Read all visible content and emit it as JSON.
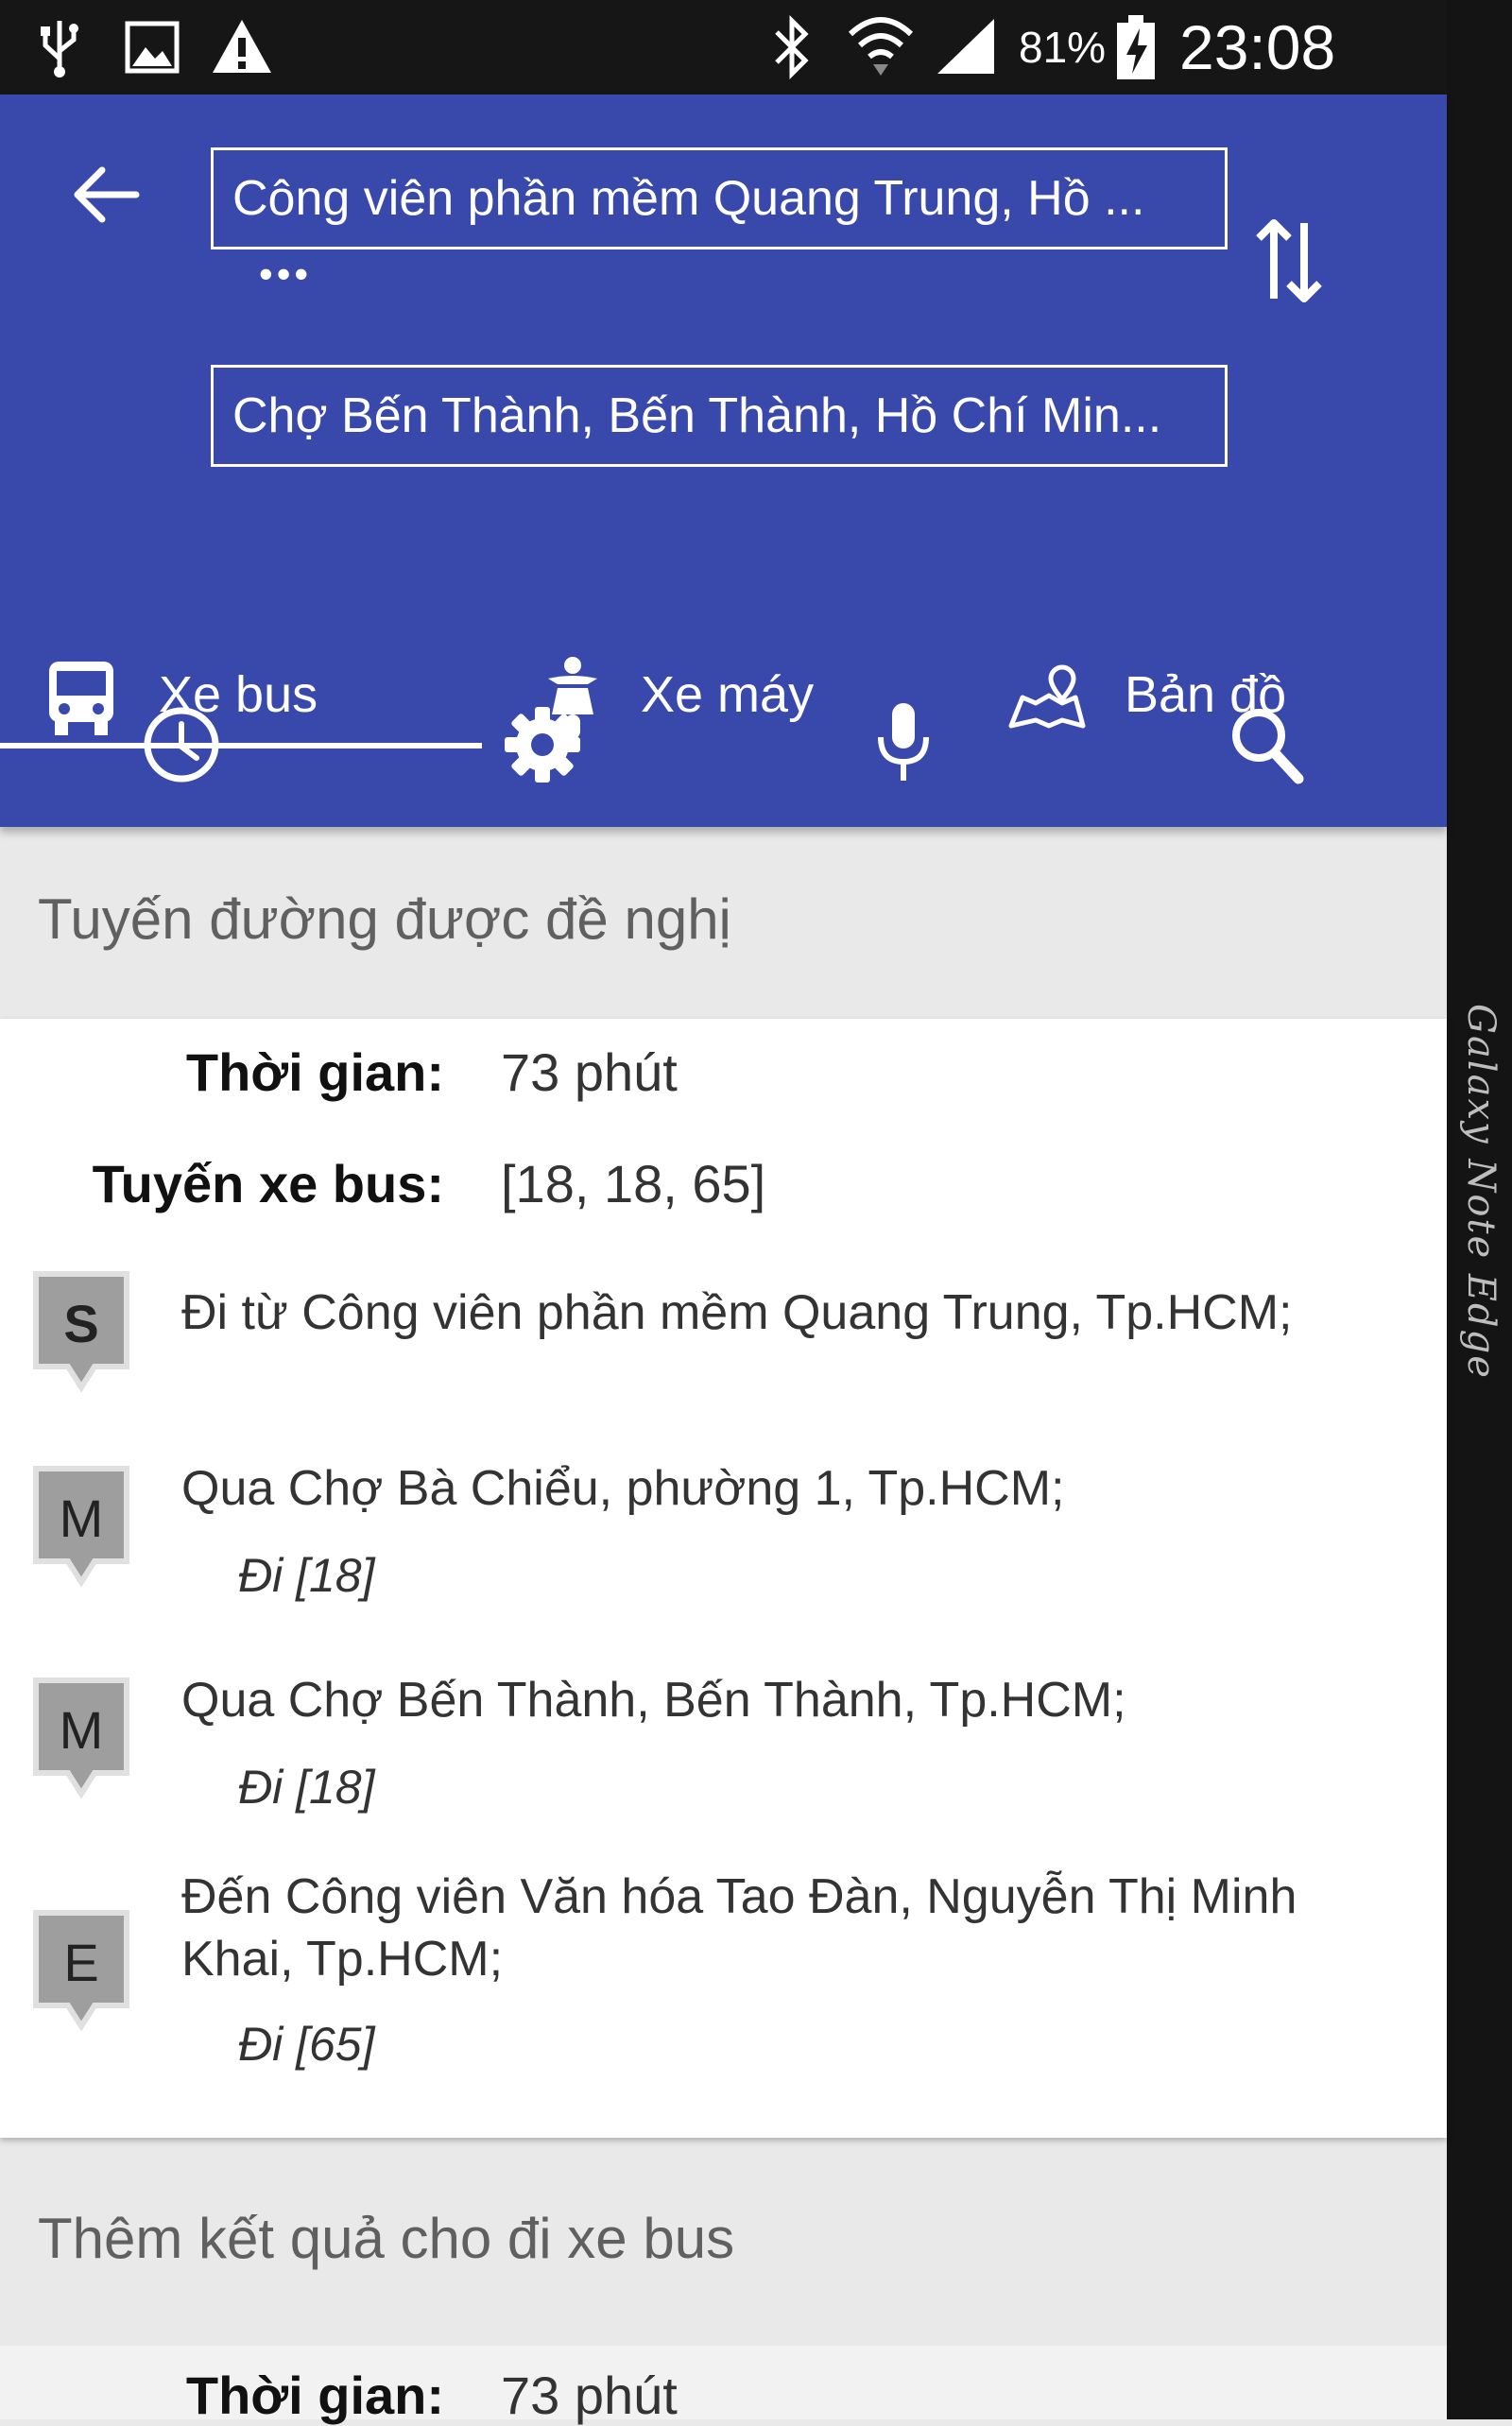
{
  "status_bar": {
    "battery": "81%",
    "time": "23:08",
    "icons": [
      "usb-icon",
      "image-icon",
      "warning-icon",
      "bluetooth-icon",
      "wifi-icon",
      "signal-icon",
      "battery-charging-icon"
    ]
  },
  "edge_panel": {
    "label": "Galaxy Note Edge"
  },
  "header": {
    "from_value": "Công viên phần mềm Quang Trung, Hồ ...",
    "to_value": "Chợ Bến Thành, Bến Thành, Hồ Chí Min...",
    "more_dots": "•••"
  },
  "tabs": [
    {
      "label": "Xe bus",
      "icon": "bus-icon",
      "selected": true
    },
    {
      "label": "Xe máy",
      "icon": "motorbike-icon",
      "selected": false
    },
    {
      "label": "Bản đồ",
      "icon": "map-icon",
      "selected": false
    }
  ],
  "toolbar": {
    "icons": [
      "clock-icon",
      "gear-icon",
      "microphone-icon",
      "search-icon"
    ]
  },
  "suggested": {
    "title": "Tuyến đường được đề nghị",
    "time_label": "Thời gian:",
    "time_value": "73 phút",
    "bus_label": "Tuyến xe bus:",
    "bus_value": "[18, 18, 65]",
    "stops": [
      {
        "marker": "S",
        "text": "Đi từ Công viên phần mềm Quang Trung, Tp.HCM;",
        "sub": ""
      },
      {
        "marker": "M",
        "text": "Qua Chợ Bà Chiểu, phường 1, Tp.HCM;",
        "sub": "Đi [18]"
      },
      {
        "marker": "M",
        "text": "Qua Chợ Bến Thành, Bến Thành, Tp.HCM;",
        "sub": "Đi [18]"
      },
      {
        "marker": "E",
        "text": "Đến Công viên Văn hóa Tao Đàn, Nguyễn Thị Minh Khai, Tp.HCM;",
        "sub": "Đi [65]"
      }
    ]
  },
  "more": {
    "title": "Thêm kết quả cho đi xe bus",
    "time_label": "Thời gian:",
    "time_value": "73 phút"
  },
  "colors": {
    "primary": "#3949ab",
    "status_bar": "#161616",
    "background": "#e9e9e9",
    "marker": "#9e9e9e"
  }
}
